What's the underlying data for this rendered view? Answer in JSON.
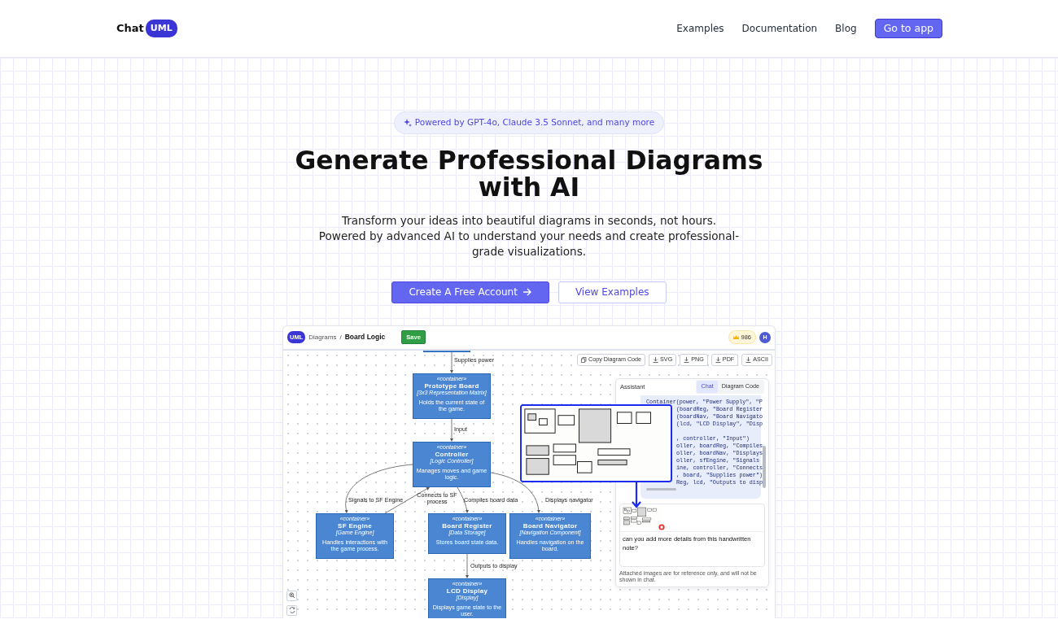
{
  "header": {
    "logo_text": "Chat",
    "logo_badge": "UML",
    "links": [
      "Examples",
      "Documentation",
      "Blog"
    ],
    "cta": "Go to app"
  },
  "hero": {
    "badge": "Powered by GPT-4o, Claude 3.5 Sonnet, and many more",
    "title": "Generate Professional Diagrams with AI",
    "subtitle": [
      "Transform your ideas into beautiful diagrams in seconds, not hours.",
      "Powered by advanced AI to understand your needs and create professional-grade visualizations."
    ],
    "buttons": [
      {
        "label": "Create A Free Account",
        "kind": "primary"
      },
      {
        "label": "View Examples",
        "kind": "outline"
      }
    ]
  },
  "app": {
    "logo": "UML",
    "breadcrumb": [
      "Diagrams",
      "Board Logic"
    ],
    "separator": "/",
    "save": "Save",
    "credits": "986",
    "avatar": "H",
    "toolbar": [
      {
        "label": "Copy Diagram Code",
        "kind": "copy"
      },
      {
        "label": "SVG",
        "kind": "download"
      },
      {
        "label": "PNG",
        "kind": "download"
      },
      {
        "label": "PDF",
        "kind": "download"
      },
      {
        "label": "ASCII",
        "kind": "download"
      }
    ],
    "nodes": [
      {
        "kind": "partial"
      },
      {
        "kind": "full",
        "stereotype": "«container»",
        "title": "Prototype Board",
        "tech": "[3x3 Representation Matrix]",
        "description": "Holds the current state of the game."
      },
      {
        "kind": "full",
        "stereotype": "«container»",
        "title": "Controller",
        "tech": "[Logic Controller]",
        "description": "Manages moves and game logic."
      },
      {
        "kind": "full",
        "stereotype": "«container»",
        "title": "SF Engine",
        "tech": "[Game Engine]",
        "description": "Handles interactions with the game process."
      },
      {
        "kind": "full",
        "stereotype": "«container»",
        "title": "Board Register",
        "tech": "[Data Storage]",
        "description": "Stores board state data."
      },
      {
        "kind": "full",
        "stereotype": "«container»",
        "title": "Board Navigator",
        "tech": "[Navigation Component]",
        "description": "Handles navigation on the board."
      },
      {
        "kind": "full",
        "stereotype": "«container»",
        "title": "LCD Display",
        "tech": "[Display]",
        "description": "Displays game state to the user."
      }
    ],
    "edges": [
      {
        "label": "Supplies power"
      },
      {
        "label": "Input"
      },
      {
        "label": "Signals to SF Engine"
      },
      {
        "label": "Connects to SF process"
      },
      {
        "label": "Compiles board data"
      },
      {
        "label": "Displays navigator"
      },
      {
        "label": "Outputs to display"
      }
    ],
    "assistant": {
      "title": "Assistant",
      "tabs": [
        {
          "label": "Chat",
          "selected": true
        },
        {
          "label": "Diagram Code",
          "selected": false
        }
      ],
      "code_blocks": [
        [
          {
            "text": "Container(power, \"Power Supply\", \"P",
            "covered": false
          },
          {
            "text": "(boardReg, \"Board Register",
            "covered": true
          },
          {
            "text": "(boardNav, \"Board Navigato",
            "covered": true
          },
          {
            "text": "(lcd, \"LCD Display\", \"Disp",
            "covered": true
          }
        ],
        [
          {
            "text": ", controller, \"Input\")",
            "covered": true
          },
          {
            "text": "oller, boardReg, \"Compiles",
            "covered": true
          },
          {
            "text": "oller, boardNav, \"Displays",
            "covered": true
          },
          {
            "text": "oller, sfEngine, \"Signals",
            "covered": true
          },
          {
            "text": "ine, controller, \"Connects",
            "covered": true
          },
          {
            "text": ", board, \"Supplies power\")",
            "covered": true
          },
          {
            "text": "Reg, lcd, \"Outputs to disp",
            "covered": true
          }
        ]
      ],
      "message": "can you add more details from this handwritten note?",
      "note": "Attached images are for reference only, and will not be shown in chat."
    }
  }
}
